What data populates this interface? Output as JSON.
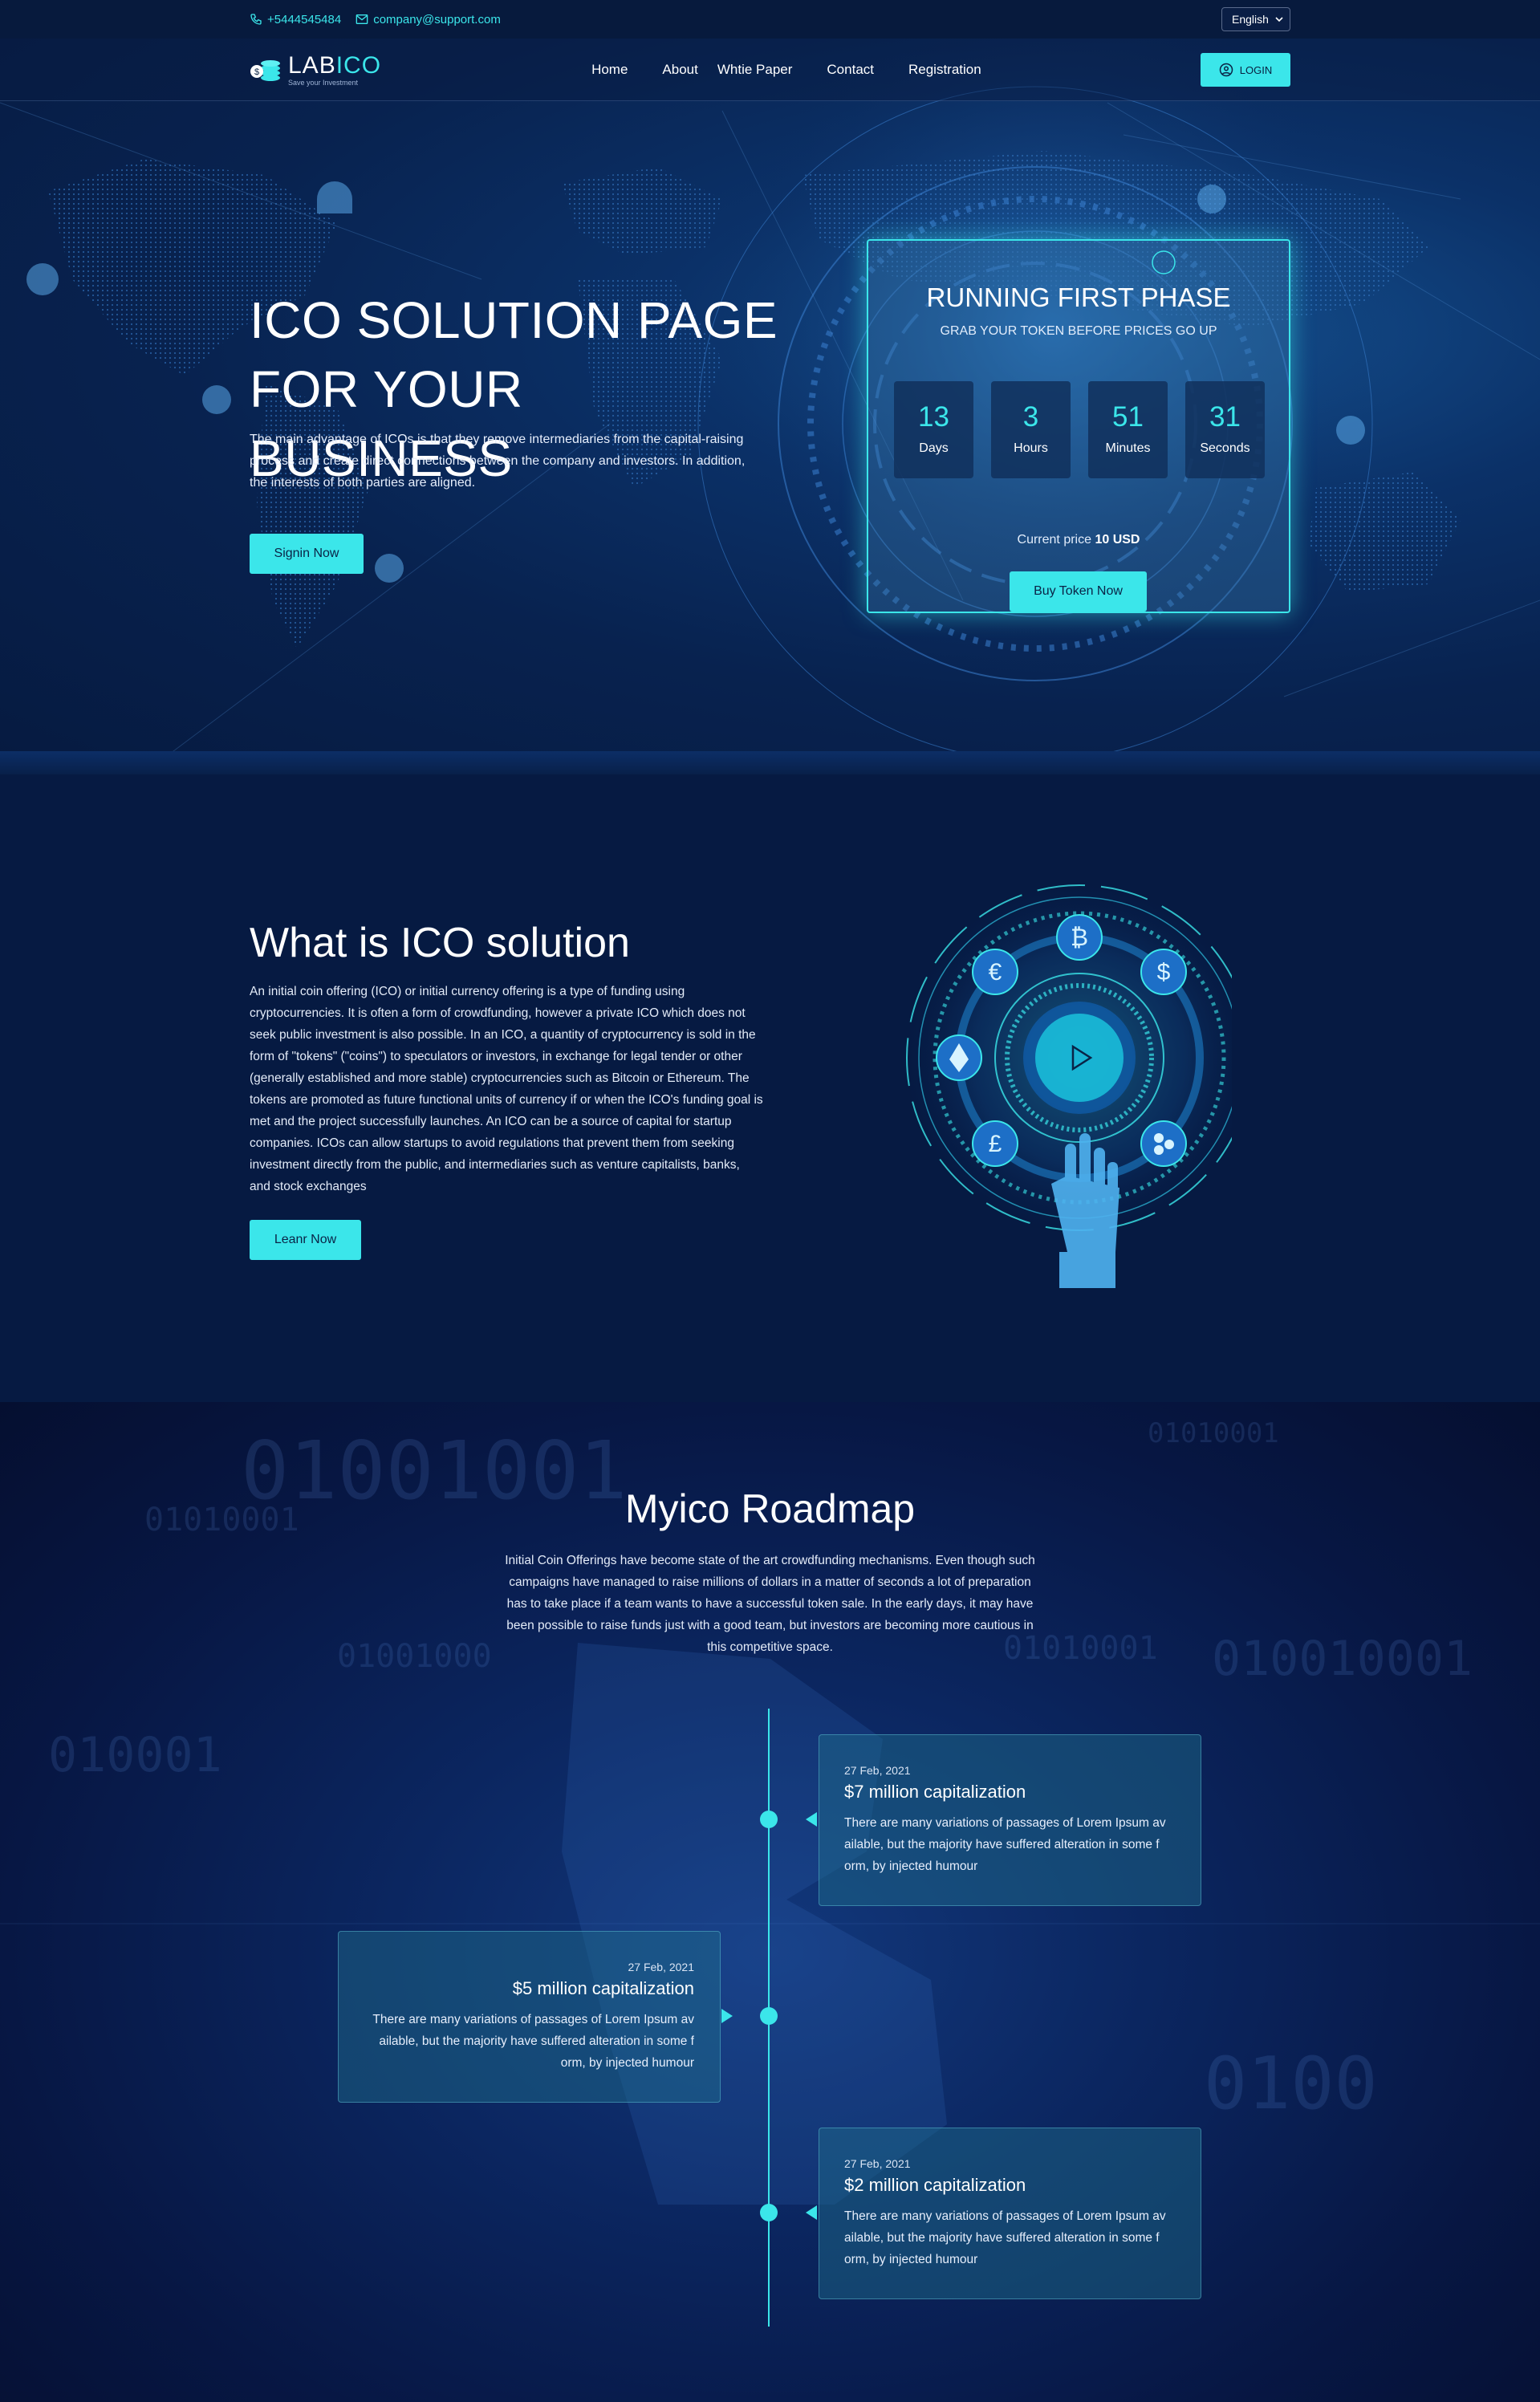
{
  "topbar": {
    "phone": "+5444545484",
    "email": "company@support.com",
    "language": "English"
  },
  "nav": {
    "logo_lab": "LAB",
    "logo_ico": "ICO",
    "logo_tagline": "Save your Investment",
    "items": [
      "Home",
      "About",
      "Whtie Paper",
      "Contact",
      "Registration"
    ],
    "login": "LOGIN"
  },
  "hero": {
    "title_line1": "ICO SOLUTION PAGE",
    "title_line2": "FOR YOUR BUSINESS",
    "lead": "The main advantage of ICOs is that they remove intermediaries from the capital-raising process and create direct connections between the company and investors. In addition, the interests of both parties are aligned.",
    "signin": "Signin Now"
  },
  "phase": {
    "title": "RUNNING FIRST PHASE",
    "subtitle": "GRAB YOUR TOKEN BEFORE PRICES GO UP",
    "timer": [
      {
        "value": "13",
        "label": "Days"
      },
      {
        "value": "3",
        "label": "Hours"
      },
      {
        "value": "51",
        "label": "Minutes"
      },
      {
        "value": "31",
        "label": "Seconds"
      }
    ],
    "price_label": "Current price",
    "price_value": "10 USD",
    "buy": "Buy Token Now"
  },
  "what": {
    "title": "What is ICO solution",
    "text": "An initial coin offering (ICO) or initial currency offering is a type of funding using cryptocurrencies. It is often a form of crowdfunding, however a private ICO which does not seek public investment is also possible. In an ICO, a quantity of cryptocurrency is sold in the form of \"tokens\" (\"coins\") to speculators or investors, in exchange for legal tender or other (generally established and more stable) cryptocurrencies such as Bitcoin or Ethereum. The tokens are promoted as future functional units of currency if or when the ICO's funding goal is met and the project successfully launches. An ICO can be a source of capital for startup companies. ICOs can allow startups to avoid regulations that prevent them from seeking investment directly from the public, and intermediaries such as venture capitalists, banks, and stock exchanges",
    "button": "Leanr Now"
  },
  "roadmap": {
    "title": "Myico Roadmap",
    "intro": "Initial Coin Offerings have become state of the art crowdfunding mechanisms. Even though such campaigns have managed to raise millions of dollars in a matter of seconds a lot of preparation has to take place if a team wants to have a successful token sale. In the early days, it may have been possible to raise funds just with a good team, but investors are becoming more cautious in this competitive space.",
    "items": [
      {
        "date": "27 Feb, 2021",
        "title": "$7 million capitalization",
        "text": "There are many variations of passages of Lorem Ipsum av ailable, but the majority have suffered alteration in some f orm, by injected humour",
        "side": "right"
      },
      {
        "date": "27 Feb, 2021",
        "title": "$5 million capitalization",
        "text": "There are many variations of passages of Lorem Ipsum av ailable, but the majority have suffered alteration in some f orm, by injected humour",
        "side": "left"
      },
      {
        "date": "27 Feb, 2021",
        "title": "$2 million capitalization",
        "text": "There are many variations of passages of Lorem Ipsum av ailable, but the majority have suffered alteration in some f orm, by injected humour",
        "side": "right"
      }
    ]
  },
  "colors": {
    "accent": "#3be6ea",
    "background": "#061a42"
  }
}
